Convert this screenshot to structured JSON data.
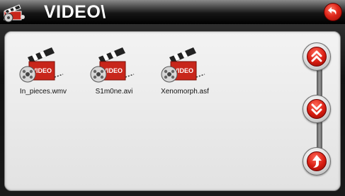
{
  "header": {
    "title": "VIDEO\\",
    "folder_icon": "video-folder-icon",
    "back_icon": "back-arrow-icon"
  },
  "files": [
    {
      "name": "In_pieces.wmv",
      "icon": "video-clapperboard-icon",
      "badge": "VIDEO"
    },
    {
      "name": "S1m0ne.avi",
      "icon": "video-clapperboard-icon",
      "badge": "VIDEO"
    },
    {
      "name": "Xenomorph.asf",
      "icon": "video-clapperboard-icon",
      "badge": "VIDEO"
    }
  ],
  "controls": {
    "page_up_icon": "double-chevron-up-icon",
    "page_down_icon": "double-chevron-down-icon",
    "parent_folder_icon": "up-arrow-icon"
  },
  "colors": {
    "accent_red": "#d81c10",
    "header_bg": "#000000",
    "panel_bg": "#ececec"
  }
}
